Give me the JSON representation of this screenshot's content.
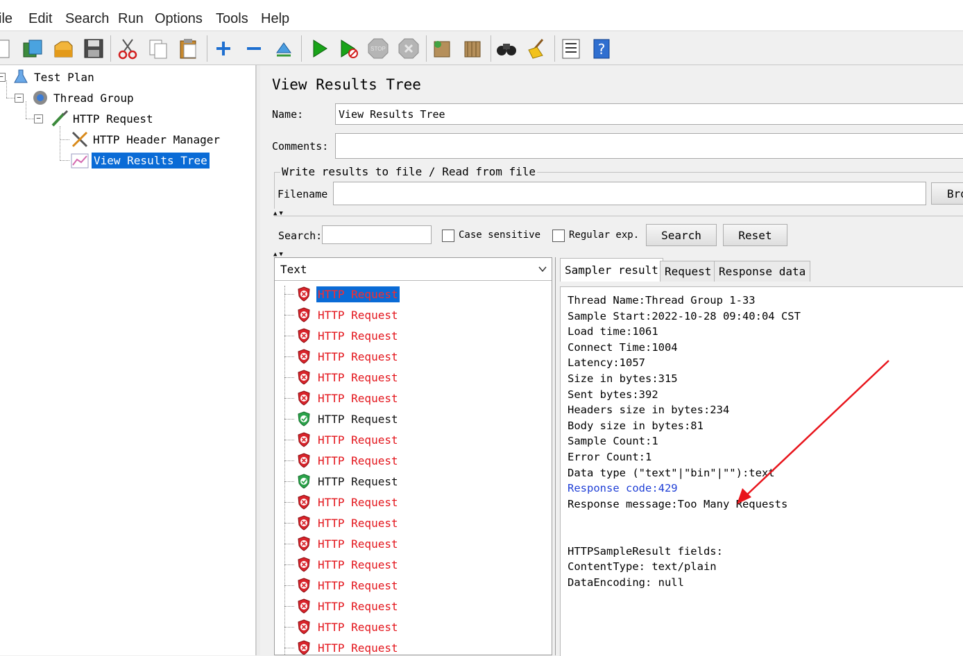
{
  "menu": [
    "File",
    "Edit",
    "Search",
    "Run",
    "Options",
    "Tools",
    "Help"
  ],
  "menu_visible": [
    "ile",
    "Edit",
    "Search",
    "Run",
    "Options",
    "Tools",
    "Help"
  ],
  "toolbar": [
    "new-icon",
    "templates-icon",
    "open-icon",
    "save-icon",
    "cut-icon",
    "copy-icon",
    "paste-icon",
    "expand-icon",
    "collapse-icon",
    "toggle-icon",
    "start-icon",
    "start-no-pause-icon",
    "stop-icon",
    "shutdown-icon",
    "clear-icon",
    "clear-all-icon",
    "search-icon",
    "reset-search-icon",
    "function-helper-icon",
    "help-icon"
  ],
  "tree": {
    "test_plan": "Test Plan",
    "thread_group": "Thread Group",
    "http_request": "HTTP Request",
    "header_manager": "HTTP Header Manager",
    "view_results_tree": "View Results Tree"
  },
  "panel": {
    "title": "View Results Tree",
    "name_label": "Name:",
    "name_value": "View Results Tree",
    "comments_label": "Comments:",
    "comments_value": "",
    "file_legend": "Write results to file / Read from file",
    "filename_label": "Filename",
    "filename_value": "",
    "browse_label": "Bro"
  },
  "search": {
    "label": "Search:",
    "value": "",
    "case_sensitive": "Case sensitive",
    "regular_exp": "Regular exp.",
    "search_button": "Search",
    "reset_button": "Reset"
  },
  "results": {
    "renderer": "Text",
    "items": [
      {
        "label": "HTTP Request",
        "status": "fail",
        "selected": true
      },
      {
        "label": "HTTP Request",
        "status": "fail"
      },
      {
        "label": "HTTP Request",
        "status": "fail"
      },
      {
        "label": "HTTP Request",
        "status": "fail"
      },
      {
        "label": "HTTP Request",
        "status": "fail"
      },
      {
        "label": "HTTP Request",
        "status": "fail"
      },
      {
        "label": "HTTP Request",
        "status": "ok"
      },
      {
        "label": "HTTP Request",
        "status": "fail"
      },
      {
        "label": "HTTP Request",
        "status": "fail"
      },
      {
        "label": "HTTP Request",
        "status": "ok"
      },
      {
        "label": "HTTP Request",
        "status": "fail"
      },
      {
        "label": "HTTP Request",
        "status": "fail"
      },
      {
        "label": "HTTP Request",
        "status": "fail"
      },
      {
        "label": "HTTP Request",
        "status": "fail"
      },
      {
        "label": "HTTP Request",
        "status": "fail"
      },
      {
        "label": "HTTP Request",
        "status": "fail"
      },
      {
        "label": "HTTP Request",
        "status": "fail"
      },
      {
        "label": "HTTP Request",
        "status": "fail"
      }
    ]
  },
  "tabs": [
    "Sampler result",
    "Request",
    "Response data"
  ],
  "sampler_result": {
    "lines": [
      "Thread Name:Thread Group 1-33",
      "Sample Start:2022-10-28 09:40:04 CST",
      "Load time:1061",
      "Connect Time:1004",
      "Latency:1057",
      "Size in bytes:315",
      "Sent bytes:392",
      "Headers size in bytes:234",
      "Body size in bytes:81",
      "Sample Count:1",
      "Error Count:1",
      "Data type (\"text\"|\"bin\"|\"\"):text",
      "Response code:429",
      "Response message:Too Many Requests",
      "",
      "",
      "HTTPSampleResult fields:",
      "ContentType: text/plain",
      "DataEncoding: null"
    ],
    "highlight_line": 12
  },
  "colors": {
    "selection": "#0a6bd6",
    "fail_text": "#e3141b",
    "response_code": "#1f3fd6",
    "annotation_arrow": "#e8141b"
  }
}
